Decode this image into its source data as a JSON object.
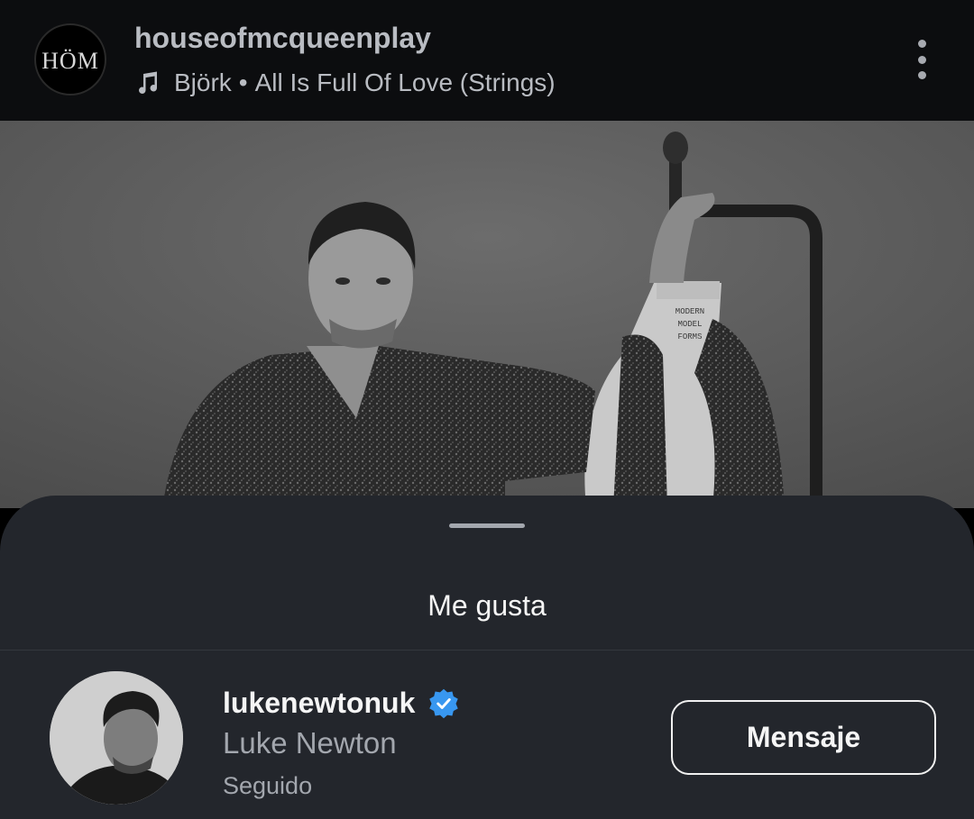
{
  "header": {
    "username": "houseofmcqueenplay",
    "avatar_logo": "HÖM",
    "music": {
      "icon": "music-note-icon",
      "artist": "Björk",
      "separator": "•",
      "track": "All Is Full Of Love (Strings)"
    },
    "more_icon": "more-vertical-icon"
  },
  "post_image": {
    "mannequin_text": "MODERN MODEL FORMS"
  },
  "sheet": {
    "title": "Me gusta",
    "likes": [
      {
        "username": "lukenewtonuk",
        "verified": true,
        "full_name": "Luke Newton",
        "status": "Seguido",
        "button_label": "Mensaje"
      }
    ]
  },
  "colors": {
    "header_bg": "#0c0d0f",
    "sheet_bg": "#23262c",
    "verified_badge": "#3897f0",
    "secondary_text": "#a3a7ae"
  }
}
